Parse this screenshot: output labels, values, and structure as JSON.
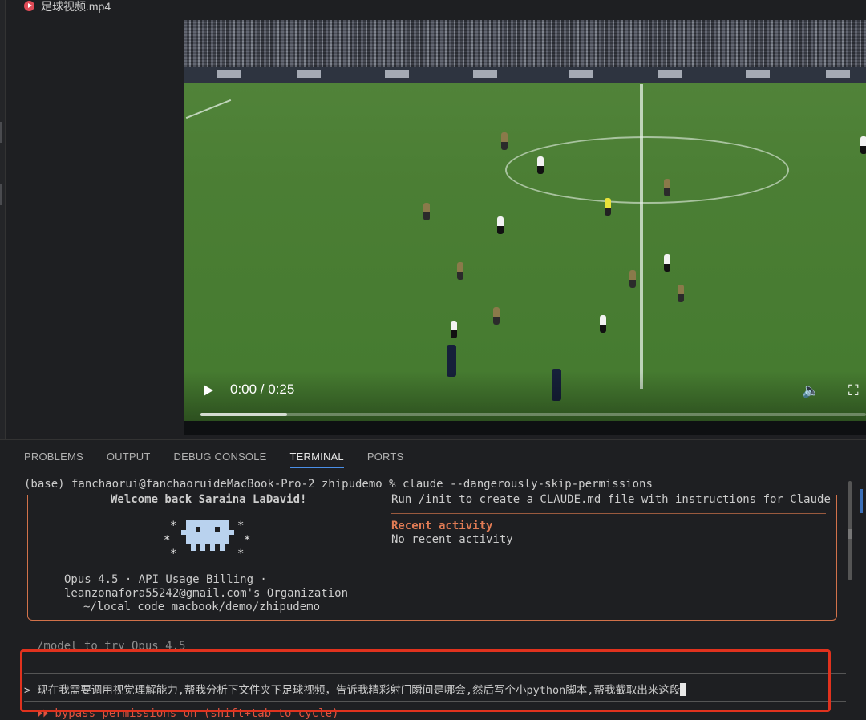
{
  "editor": {
    "file_tab_label": "足球视频.mp4"
  },
  "video": {
    "time_display": "0:00 / 0:25",
    "progress_fraction": 0.0,
    "buffered_fraction": 0.13
  },
  "panel": {
    "tabs": [
      "PROBLEMS",
      "OUTPUT",
      "DEBUG CONSOLE",
      "TERMINAL",
      "PORTS"
    ],
    "active_tab": "TERMINAL"
  },
  "terminal": {
    "command_line": "(base) fanchaorui@fanchaoruideMacBook-Pro-2 zhipudemo % claude --dangerously-skip-permissions",
    "welcome": "Welcome back Saraina LaDavid!",
    "info_line1": "Opus 4.5 · API Usage Billing ·",
    "info_line2": "leanzonafora55242@gmail.com's Organization",
    "info_line3": "~/local_code_macbook/demo/zhipudemo",
    "tips_text": "Run /init to create a CLAUDE.md file with instructions for Claude",
    "recent_title": "Recent activity",
    "recent_text": "No recent activity",
    "model_hint": "/model to try Opus 4.5",
    "prompt_text": "> 现在我需要调用视觉理解能力,帮我分析下文件夹下足球视频，告诉我精彩射门瞬间是哪会,然后写个小python脚本,帮我截取出来这段",
    "bypass_text": "⏵⏵ bypass permissions on (shift+tab to cycle)"
  },
  "colors": {
    "accent_orange": "#e07b54",
    "highlight_red": "#e0321e",
    "tab_underline": "#4a8fe8"
  }
}
